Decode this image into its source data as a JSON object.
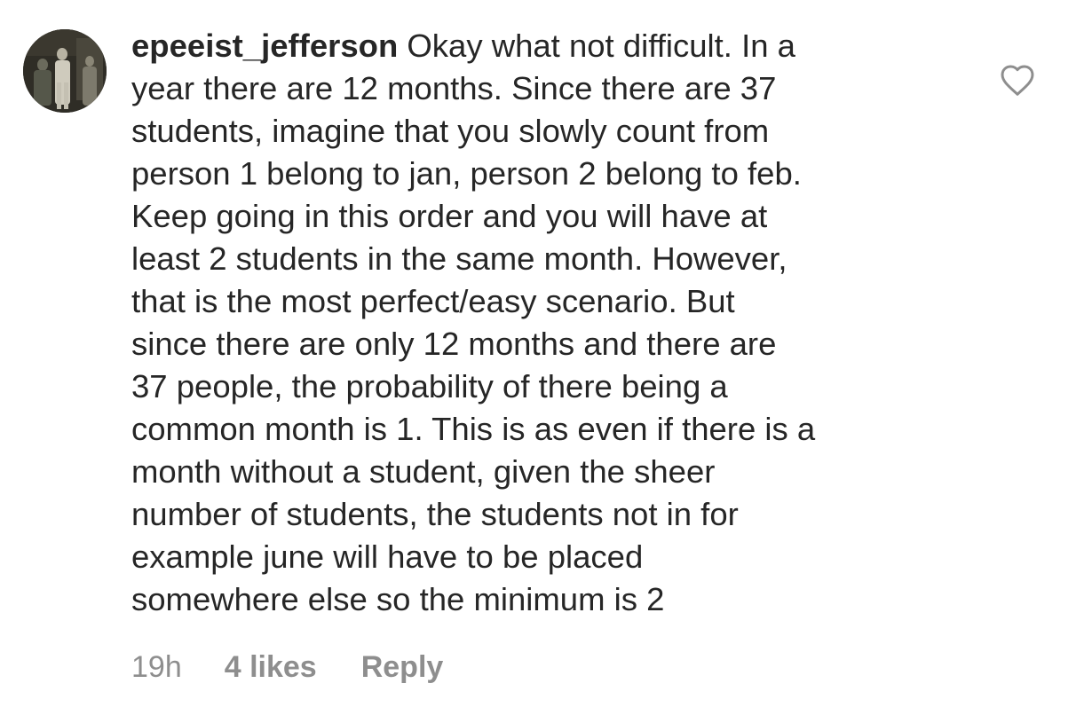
{
  "comment": {
    "username": "epeeist_jefferson",
    "text_lines": [
      "Okay what not difficult. In a",
      "year there are 12 months. Since there are 37",
      "students, imagine that you slowly count from",
      "person 1 belong to jan, person 2 belong to feb.",
      "Keep going in this order and you will have at",
      "least 2 students in the same month. However,",
      "that is the most perfect/easy scenario. But",
      "since there are only 12 months and there are",
      "37 people, the probability of there being a",
      "common month is 1. This is as even if there is a",
      "month without a student, given the sheer",
      "number of students, the students not in for",
      "example june will have to be placed",
      "somewhere else so the minimum is 2"
    ],
    "time": "19h",
    "likes": "4 likes",
    "reply_label": "Reply",
    "like_icon": "heart-outline-icon",
    "avatar_icon": "profile-photo"
  },
  "colors": {
    "text": "#262626",
    "meta": "#8e8e8e",
    "icon": "#8e8e8e"
  }
}
